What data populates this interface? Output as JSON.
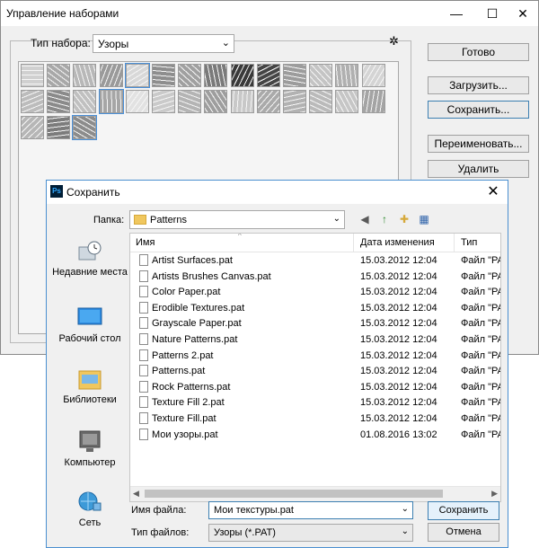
{
  "preset_manager": {
    "title": "Управление наборами",
    "minimize_glyph": "—",
    "maximize_glyph": "☐",
    "close_glyph": "✕",
    "set_type_label": "Тип набора:",
    "set_type_value": "Узоры",
    "set_type_arrow": "⌄",
    "gear_glyph": "✲",
    "buttons": {
      "done": "Готово",
      "load": "Загрузить...",
      "save": "Сохранить...",
      "rename": "Переименовать...",
      "delete": "Удалить"
    }
  },
  "save_dialog": {
    "title": "Сохранить",
    "ps_label": "Ps",
    "close_glyph": "✕",
    "folder_label": "Папка:",
    "folder_value": "Patterns",
    "dropdown_glyph": "⌄",
    "nav_glyphs": {
      "back": "◀",
      "up": "↑",
      "new_folder": "✚",
      "view": "▦"
    },
    "places": [
      {
        "label": "Недавние места",
        "icon": "recent-places-icon"
      },
      {
        "label": "Рабочий стол",
        "icon": "desktop-icon"
      },
      {
        "label": "Библиотеки",
        "icon": "libraries-icon"
      },
      {
        "label": "Компьютер",
        "icon": "computer-icon"
      },
      {
        "label": "Сеть",
        "icon": "network-icon"
      }
    ],
    "columns": {
      "name": "Имя",
      "date": "Дата изменения",
      "type": "Тип"
    },
    "sort_glyph": "^",
    "files": [
      {
        "name": "Artist Surfaces.pat",
        "date": "15.03.2012 12:04",
        "type": "Файл \"PA"
      },
      {
        "name": "Artists Brushes Canvas.pat",
        "date": "15.03.2012 12:04",
        "type": "Файл \"PA"
      },
      {
        "name": "Color Paper.pat",
        "date": "15.03.2012 12:04",
        "type": "Файл \"PA"
      },
      {
        "name": "Erodible Textures.pat",
        "date": "15.03.2012 12:04",
        "type": "Файл \"PA"
      },
      {
        "name": "Grayscale Paper.pat",
        "date": "15.03.2012 12:04",
        "type": "Файл \"PA"
      },
      {
        "name": "Nature Patterns.pat",
        "date": "15.03.2012 12:04",
        "type": "Файл \"PA"
      },
      {
        "name": "Patterns 2.pat",
        "date": "15.03.2012 12:04",
        "type": "Файл \"PA"
      },
      {
        "name": "Patterns.pat",
        "date": "15.03.2012 12:04",
        "type": "Файл \"PA"
      },
      {
        "name": "Rock Patterns.pat",
        "date": "15.03.2012 12:04",
        "type": "Файл \"PA"
      },
      {
        "name": "Texture Fill 2.pat",
        "date": "15.03.2012 12:04",
        "type": "Файл \"PA"
      },
      {
        "name": "Texture Fill.pat",
        "date": "15.03.2012 12:04",
        "type": "Файл \"PA"
      },
      {
        "name": "Мои узоры.pat",
        "date": "01.08.2016 13:02",
        "type": "Файл \"PA"
      }
    ],
    "scroll_left_glyph": "◀",
    "scroll_right_glyph": "▶",
    "filename_label": "Имя файла:",
    "filename_value": "Мои текстуры.pat",
    "filetype_label": "Тип файлов:",
    "filetype_value": "Узоры (*.PAT)",
    "save_button": "Сохранить",
    "cancel_button": "Отмена"
  },
  "colors": {
    "dialog_border": "#4a8fd0",
    "focus_border": "#3c7fb1",
    "folder_yellow": "#f0c75e"
  }
}
